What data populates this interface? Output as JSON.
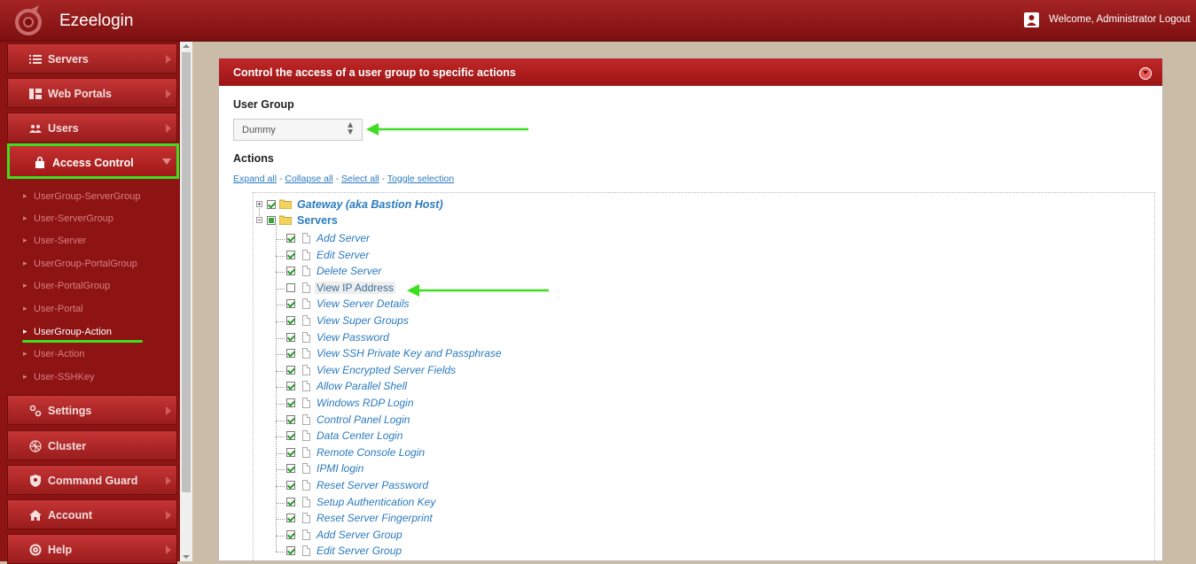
{
  "app": {
    "title": "Ezeelogin",
    "welcome": "Welcome, Administrator",
    "logout": "Logout"
  },
  "colors": {
    "accent": "#9c1414",
    "highlight": "#3dde1f",
    "link": "#2b7bbf"
  },
  "sidebar": {
    "menus": [
      {
        "label": "Servers",
        "icon": "list-icon"
      },
      {
        "label": "Web Portals",
        "icon": "grid-icon"
      },
      {
        "label": "Users",
        "icon": "users-icon"
      },
      {
        "label": "Access Control",
        "icon": "lock-icon",
        "active": true
      },
      {
        "label": "Settings",
        "icon": "gears-icon"
      },
      {
        "label": "Cluster",
        "icon": "cluster-icon"
      },
      {
        "label": "Command Guard",
        "icon": "shield-icon"
      },
      {
        "label": "Account",
        "icon": "home-icon"
      },
      {
        "label": "Help",
        "icon": "lifebuoy-icon"
      }
    ],
    "submenu": [
      "UserGroup-ServerGroup",
      "User-ServerGroup",
      "User-Server",
      "UserGroup-PortalGroup",
      "User-PortalGroup",
      "User-Portal",
      "UserGroup-Action",
      "User-Action",
      "User-SSHKey"
    ],
    "current_submenu": "UserGroup-Action"
  },
  "panel": {
    "title": "Control the access of a user group to specific actions",
    "user_group_label": "User Group",
    "user_group_value": "Dummy",
    "actions_label": "Actions",
    "links": [
      "Expand all",
      "Collapse all",
      "Select all",
      "Toggle selection"
    ],
    "separator": " - "
  },
  "tree": {
    "groups": [
      {
        "label": "Gateway (aka Bastion Host)",
        "checked": true,
        "expanded": false
      },
      {
        "label": "Servers",
        "checked": "partial",
        "expanded": true
      }
    ],
    "server_actions": [
      {
        "label": "Add Server",
        "checked": true
      },
      {
        "label": "Edit Server",
        "checked": true
      },
      {
        "label": "Delete Server",
        "checked": true
      },
      {
        "label": "View IP Address",
        "checked": false
      },
      {
        "label": "View Server Details",
        "checked": true
      },
      {
        "label": "View Super Groups",
        "checked": true
      },
      {
        "label": "View Password",
        "checked": true
      },
      {
        "label": "View SSH Private Key and Passphrase",
        "checked": true
      },
      {
        "label": "View Encrypted Server Fields",
        "checked": true
      },
      {
        "label": "Allow Parallel Shell",
        "checked": true
      },
      {
        "label": "Windows RDP Login",
        "checked": true
      },
      {
        "label": "Control Panel Login",
        "checked": true
      },
      {
        "label": "Data Center Login",
        "checked": true
      },
      {
        "label": "Remote Console Login",
        "checked": true
      },
      {
        "label": "IPMI login",
        "checked": true
      },
      {
        "label": "Reset Server Password",
        "checked": true
      },
      {
        "label": "Setup Authentication Key",
        "checked": true
      },
      {
        "label": "Reset Server Fingerprint",
        "checked": true
      },
      {
        "label": "Add Server Group",
        "checked": true
      },
      {
        "label": "Edit Server Group",
        "checked": true
      }
    ]
  }
}
